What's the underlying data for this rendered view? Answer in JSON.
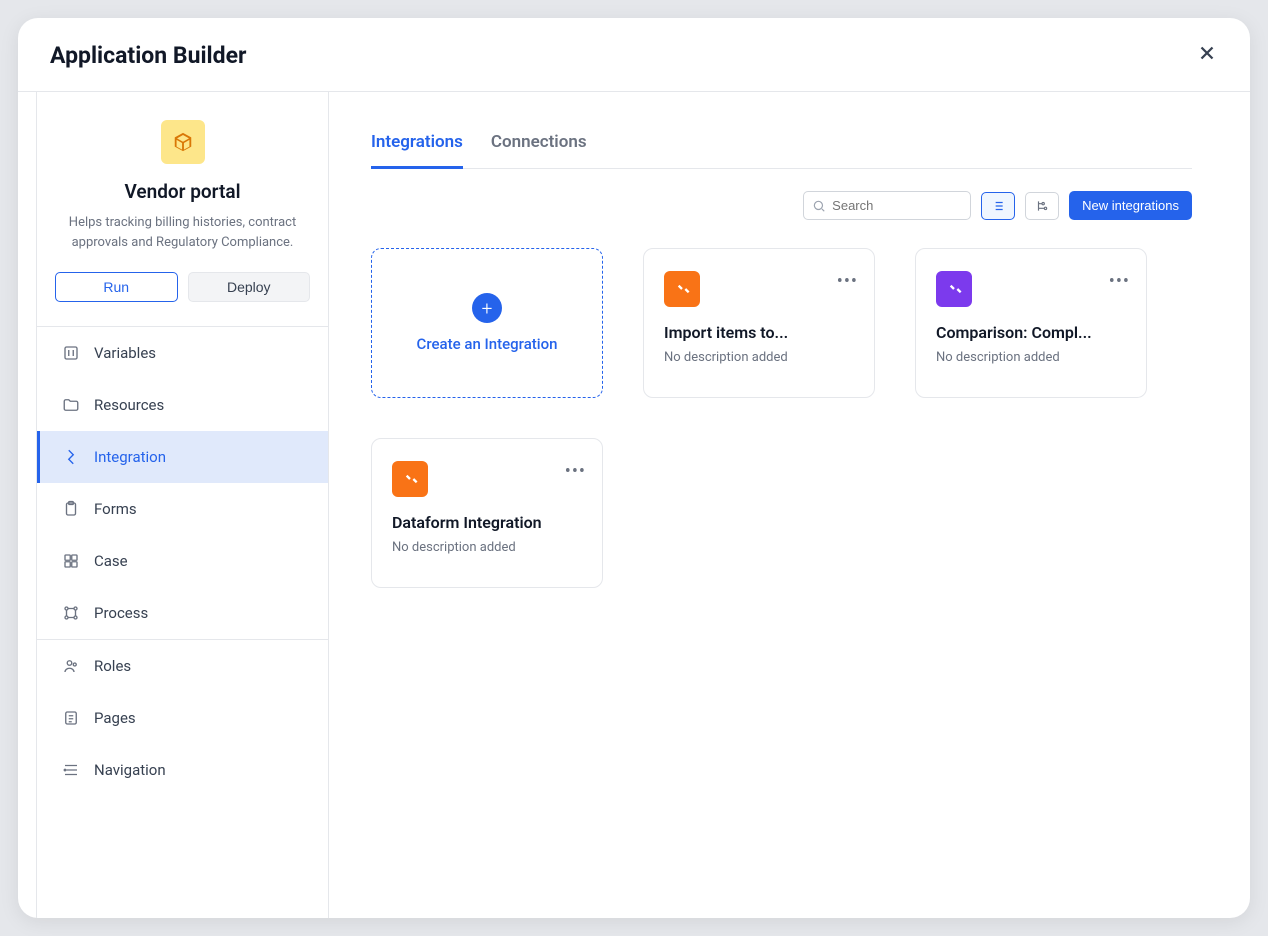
{
  "header": {
    "title": "Application Builder"
  },
  "app": {
    "name": "Vendor portal",
    "description": "Helps tracking billing histories, contract approvals and Regulatory Compliance.",
    "run_label": "Run",
    "deploy_label": "Deploy"
  },
  "nav": {
    "items": [
      {
        "label": "Variables",
        "icon": "variable-icon"
      },
      {
        "label": "Resources",
        "icon": "folder-icon"
      },
      {
        "label": "Integration",
        "icon": "plug-icon",
        "active": true
      },
      {
        "label": "Forms",
        "icon": "clipboard-icon"
      },
      {
        "label": "Case",
        "icon": "grid-icon"
      },
      {
        "label": "Process",
        "icon": "process-icon"
      },
      {
        "label": "Roles",
        "icon": "roles-icon"
      },
      {
        "label": "Pages",
        "icon": "pages-icon"
      },
      {
        "label": "Navigation",
        "icon": "navigation-icon"
      }
    ]
  },
  "tabs": [
    {
      "label": "Integrations",
      "active": true
    },
    {
      "label": "Connections"
    }
  ],
  "toolbar": {
    "search_placeholder": "Search",
    "new_button": "New integrations"
  },
  "create_card": {
    "label": "Create an Integration"
  },
  "integrations": [
    {
      "title": "Import items to...",
      "description": "No description added",
      "color": "orange"
    },
    {
      "title": "Comparison: Compl...",
      "description": "No description added",
      "color": "purple"
    },
    {
      "title": "Dataform Integration",
      "description": "No description added",
      "color": "orange"
    }
  ]
}
